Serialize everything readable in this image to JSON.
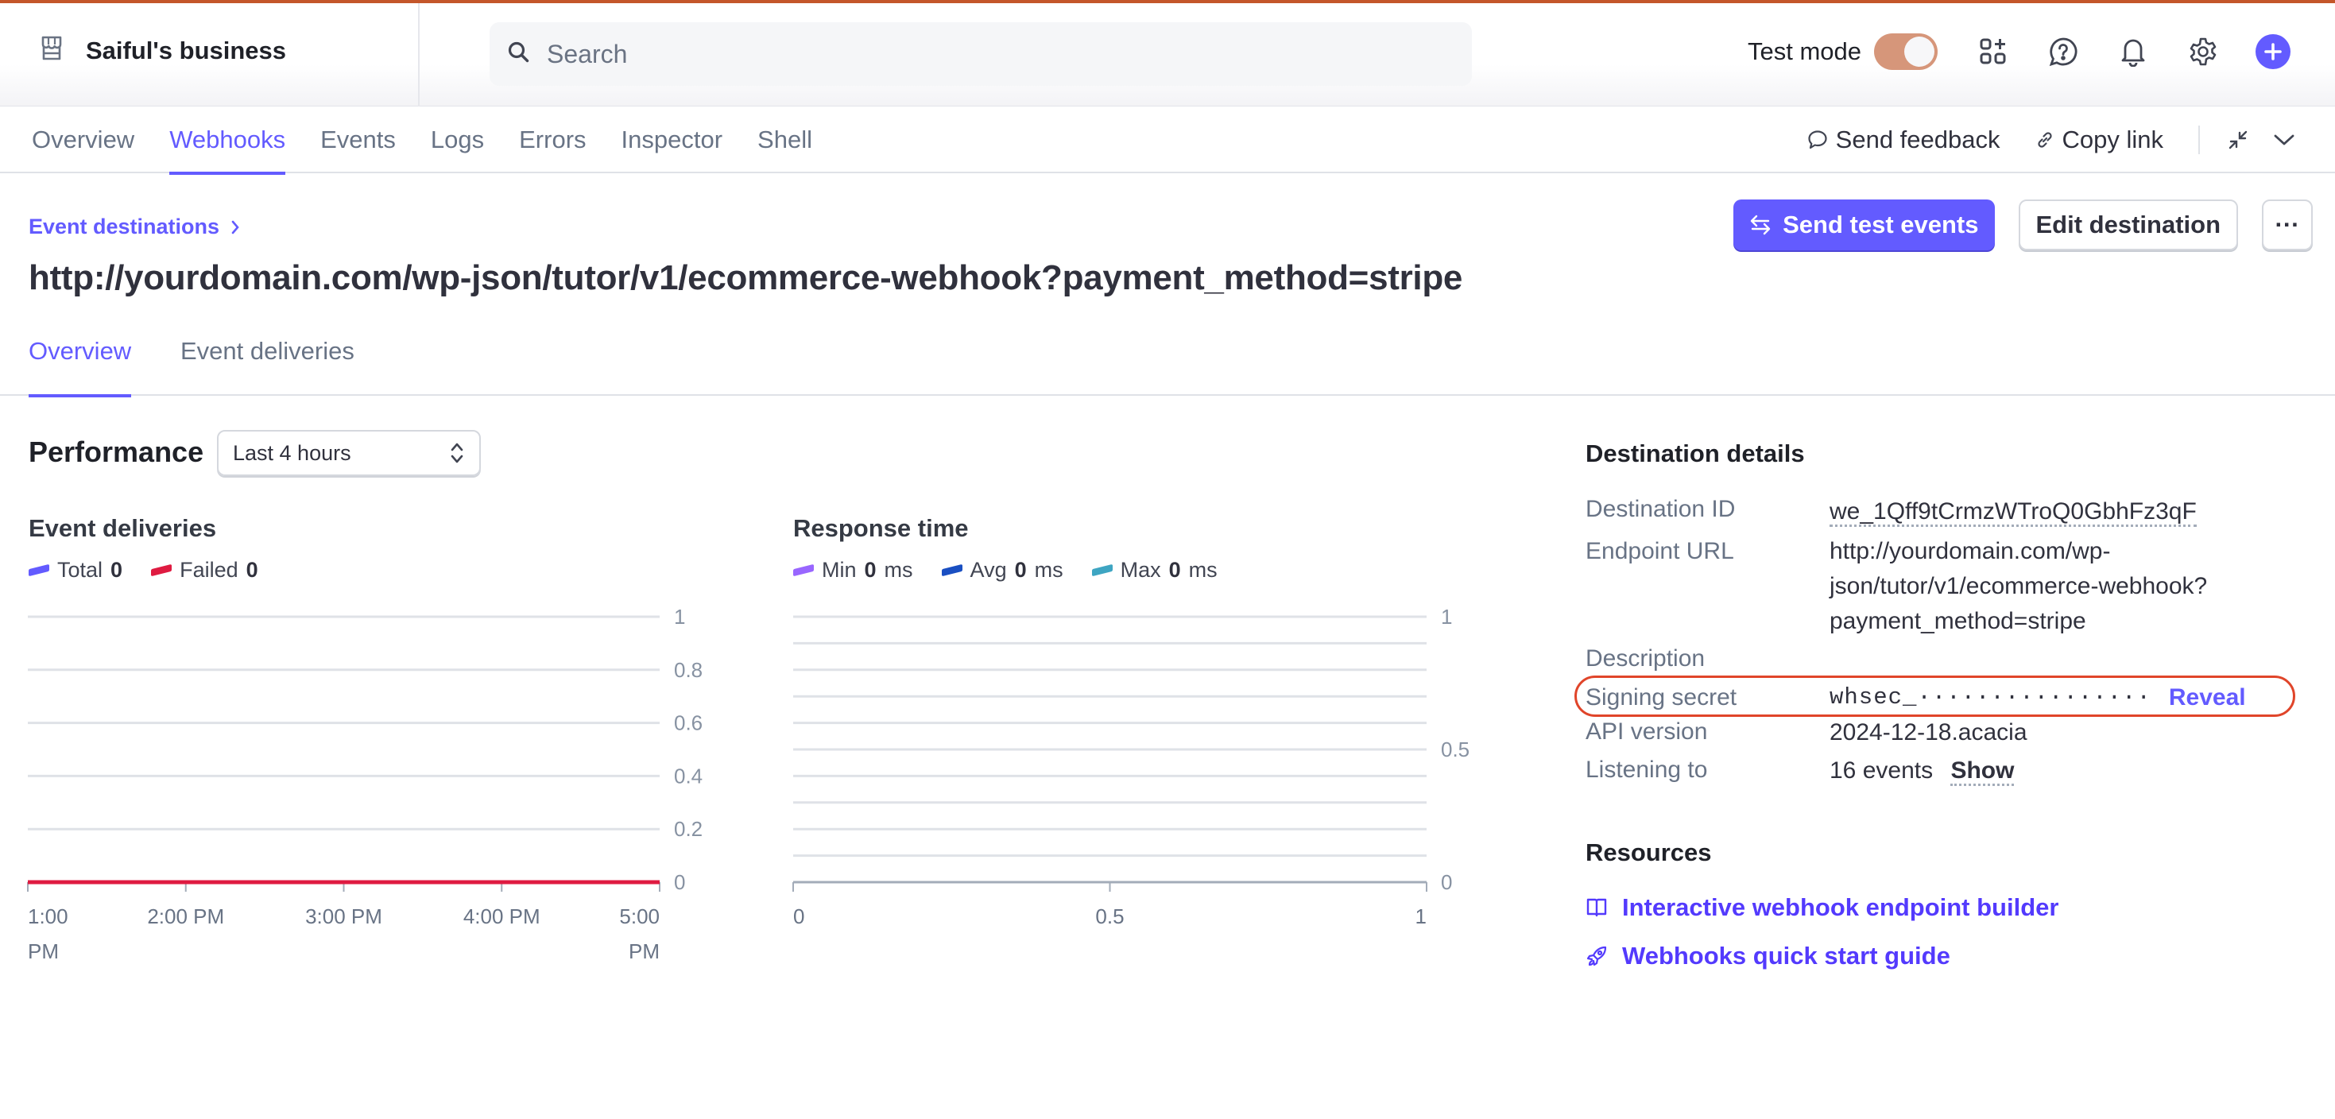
{
  "topbar": {
    "account_name": "Saiful's business",
    "search_placeholder": "Search",
    "test_mode_label": "Test mode",
    "test_mode_on": true,
    "icons": [
      "apps-icon",
      "help-icon",
      "bell-icon",
      "gear-icon",
      "plus-icon"
    ]
  },
  "nav": {
    "tabs": [
      {
        "label": "Overview",
        "active": false
      },
      {
        "label": "Webhooks",
        "active": true
      },
      {
        "label": "Events",
        "active": false
      },
      {
        "label": "Logs",
        "active": false
      },
      {
        "label": "Errors",
        "active": false
      },
      {
        "label": "Inspector",
        "active": false
      },
      {
        "label": "Shell",
        "active": false
      }
    ],
    "send_feedback": "Send feedback",
    "copy_link": "Copy link"
  },
  "header": {
    "breadcrumb": "Event destinations",
    "title": "http://yourdomain.com/wp-json/tutor/v1/ecommerce-webhook?payment_method=stripe",
    "send_test_events": "Send test events",
    "edit_destination": "Edit destination",
    "more": "···"
  },
  "subtabs": [
    {
      "label": "Overview",
      "active": true
    },
    {
      "label": "Event deliveries",
      "active": false
    }
  ],
  "performance": {
    "title": "Performance",
    "range": "Last 4 hours"
  },
  "chart_data": [
    {
      "type": "line",
      "title": "Event deliveries",
      "x": [
        "1:00 PM",
        "2:00 PM",
        "3:00 PM",
        "4:00 PM",
        "5:00 PM"
      ],
      "xtick_labels": [
        [
          "1:00",
          "PM"
        ],
        [
          "2:00 PM"
        ],
        [
          "3:00 PM"
        ],
        [
          "4:00 PM"
        ],
        [
          "5:00",
          "PM"
        ]
      ],
      "series": [
        {
          "name": "Total",
          "total": "0",
          "color": "#635bff",
          "values": [
            0,
            0,
            0,
            0,
            0
          ]
        },
        {
          "name": "Failed",
          "total": "0",
          "color": "#df1b41",
          "values": [
            0,
            0,
            0,
            0,
            0
          ]
        }
      ],
      "yticks": [
        "0",
        "0.2",
        "0.4",
        "0.6",
        "0.8",
        "1"
      ],
      "ylim": [
        0,
        1
      ],
      "grid": true,
      "legend": "top-left",
      "xlabel": "",
      "ylabel": ""
    },
    {
      "type": "line",
      "title": "Response time",
      "x": [
        0,
        0.5,
        1
      ],
      "xtick_labels": [
        [
          "0"
        ],
        [
          "0.5"
        ],
        [
          "1"
        ]
      ],
      "series": [
        {
          "name": "Min",
          "total": "0",
          "unit": "ms",
          "color": "#9966ff",
          "values": []
        },
        {
          "name": "Avg",
          "total": "0",
          "unit": "ms",
          "color": "#1a4fc2",
          "values": []
        },
        {
          "name": "Max",
          "total": "0",
          "unit": "ms",
          "color": "#3ea5c2",
          "values": []
        }
      ],
      "yticks": [
        "0",
        "0.5",
        "1"
      ],
      "ylim": [
        0,
        1
      ],
      "gridlines": 10,
      "grid": true,
      "legend": "top-left",
      "xlabel": "",
      "ylabel": ""
    }
  ],
  "details": {
    "title": "Destination details",
    "destination_id_label": "Destination ID",
    "destination_id": "we_1Qff9tCrmzWTroQ0GbhFz3qF",
    "endpoint_label": "Endpoint URL",
    "endpoint_lines": [
      "http://yourdomain.com/wp-",
      "json/tutor/v1/ecommerce-webhook?",
      "payment_method=stripe"
    ],
    "description_label": "Description",
    "description": "",
    "secret_label": "Signing secret",
    "secret_value": "whsec_················",
    "reveal": "Reveal",
    "api_label": "API version",
    "api_version": "2024-12-18.acacia",
    "listening_label": "Listening to",
    "listening_value": "16 events",
    "show": "Show"
  },
  "resources": {
    "title": "Resources",
    "links": [
      {
        "label": "Interactive webhook endpoint builder",
        "icon": "book-icon"
      },
      {
        "label": "Webhooks quick start guide",
        "icon": "rocket-icon"
      }
    ]
  }
}
